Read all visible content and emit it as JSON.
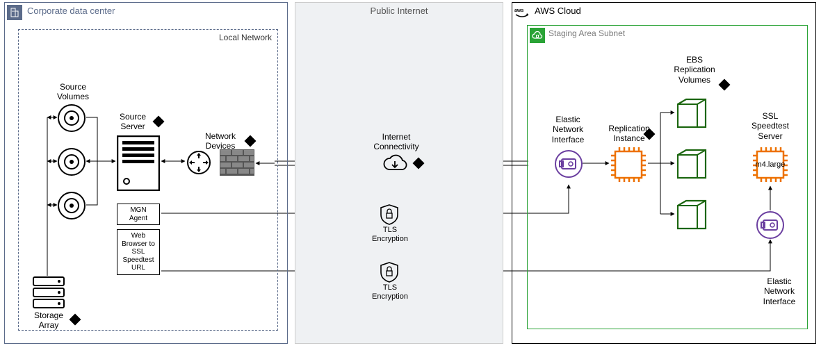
{
  "corporate": {
    "title": "Corporate data center",
    "local_network": "Local Network",
    "source_volumes": "Source\nVolumes",
    "source_server": "Source\nServer",
    "network_devices": "Network\nDevices",
    "mgn_agent": "MGN\nAgent",
    "web_browser": "Web\nBrowser to\nSSL\nSpeedtest\nURL",
    "storage_array": "Storage\nArray"
  },
  "public_internet": {
    "title": "Public Internet",
    "internet_connectivity": "Internet\nConnectivity",
    "tls1": "TLS\nEncryption",
    "tls2": "TLS\nEncryption"
  },
  "aws": {
    "title": "AWS Cloud",
    "staging_area": "Staging Area Subnet",
    "eni1": "Elastic\nNetwork\nInterface",
    "replication_instance": "Replication\nInstance",
    "ebs_volumes": "EBS\nReplication\nVolumes",
    "ssl_server": "SSL\nSpeedtest\nServer",
    "ssl_size": "m4.large",
    "eni2": "Elastic\nNetwork\nInterface"
  },
  "colors": {
    "corporate_border": "#5b6b8a",
    "internet_bg": "#eff1f3",
    "aws_border": "#000",
    "staging_border": "#2aa336",
    "staging_icon_bg": "#2aa336",
    "ec2_orange": "#ed7100",
    "storage_green": "#1b660f",
    "eni_purple": "#6b3fa0"
  }
}
